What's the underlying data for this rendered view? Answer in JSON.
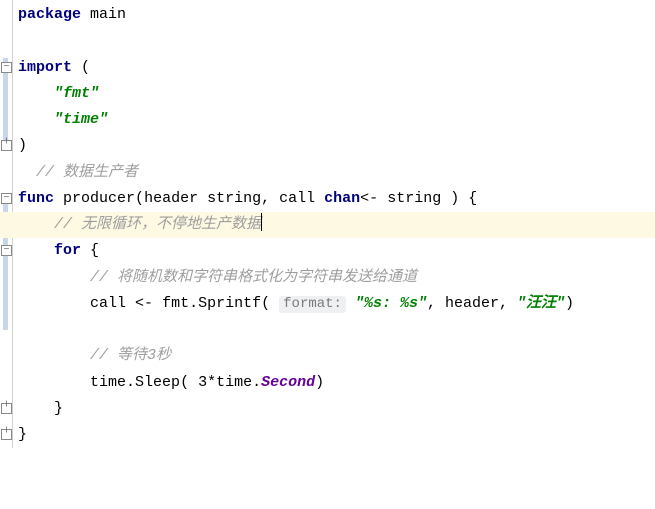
{
  "code": {
    "pkg_kw": "package",
    "pkg_name": "main",
    "import_kw": "import",
    "import_fmt": "\"fmt\"",
    "import_time": "\"time\"",
    "cmt_producer": "// 数据生产者",
    "func_kw": "func",
    "func_name": "producer",
    "param_header": "header",
    "type_string1": "string",
    "param_call": "call",
    "chan_kw": "chan",
    "chan_arrow": "<-",
    "type_string2": "string",
    "cmt_loop": "// 无限循环，不停地生产数据",
    "for_kw": "for",
    "cmt_send": "// 将随机数和字符串格式化为字符串发送给通道",
    "call_var": "call",
    "send_op": "<-",
    "fmt_pkg": "fmt",
    "sprintf": "Sprintf",
    "hint_format": "format:",
    "fmt_str": "\"%s: %s\"",
    "arg_header": "header",
    "arg_literal": "\"汪汪\"",
    "cmt_wait": "// 等待3秒",
    "time_pkg": "time",
    "sleep": "Sleep",
    "three": "3",
    "star": "*",
    "time_pkg2": "time",
    "second": "Second"
  }
}
